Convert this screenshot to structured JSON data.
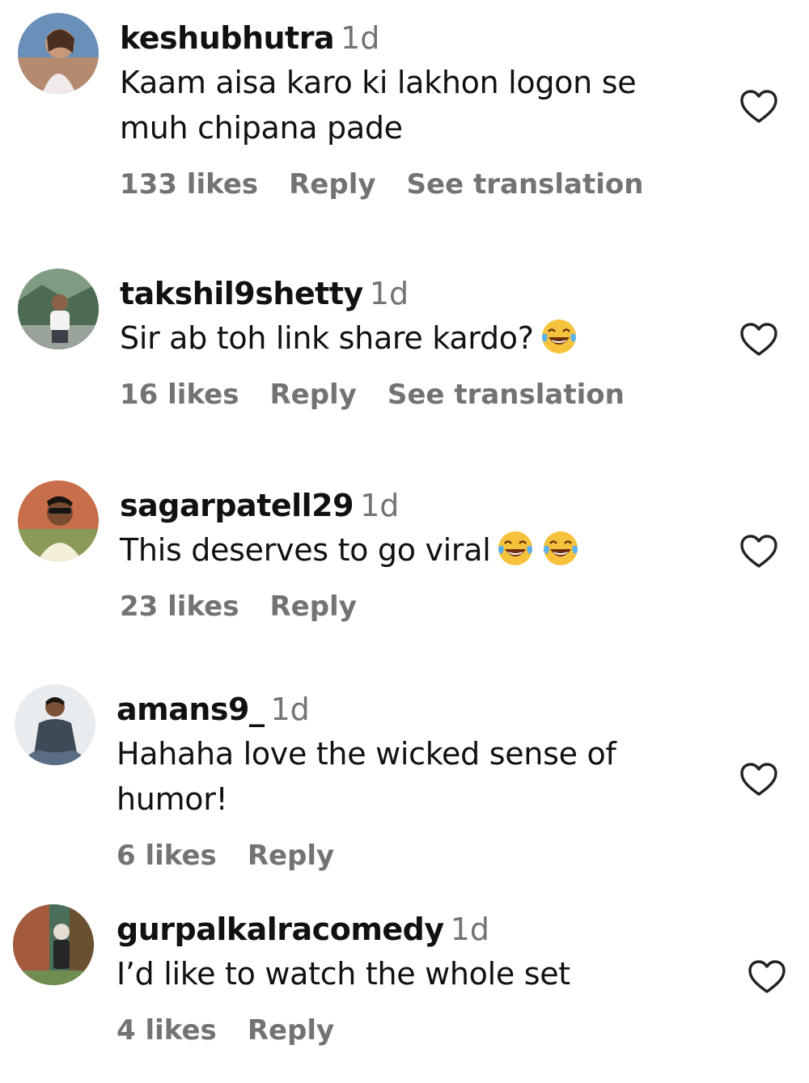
{
  "accent": {
    "meta_gray": "#737373",
    "heart_stroke": "#222222"
  },
  "comments": [
    {
      "username": "keshubhutra",
      "time": "1d",
      "text": "Kaam aisa karo ki lakhon logon se muh chipana pade",
      "likes": "133 likes",
      "reply": "Reply",
      "translation": "See translation",
      "emojis": 0
    },
    {
      "username": "takshil9shetty",
      "time": "1d",
      "text": "Sir ab toh link share kardo?",
      "likes": "16 likes",
      "reply": "Reply",
      "translation": "See translation",
      "emojis": 1,
      "emoji_name": "face-with-tears-of-joy-icon"
    },
    {
      "username": "sagarpatell29",
      "time": "1d",
      "text": "This deserves to go viral",
      "likes": "23 likes",
      "reply": "Reply",
      "emojis": 2,
      "emoji_name": "face-with-tears-of-joy-icon"
    },
    {
      "username": "amans9_",
      "time": "1d",
      "text": "Hahaha love the wicked sense of humor!",
      "likes": "6 likes",
      "reply": "Reply",
      "emojis": 0
    },
    {
      "username": "gurpalkalracomedy",
      "time": "1d",
      "text": "I’d like to watch the whole set",
      "likes": "4 likes",
      "reply": "Reply",
      "emojis": 0
    }
  ],
  "icons": {
    "like": "heart-outline-icon"
  }
}
